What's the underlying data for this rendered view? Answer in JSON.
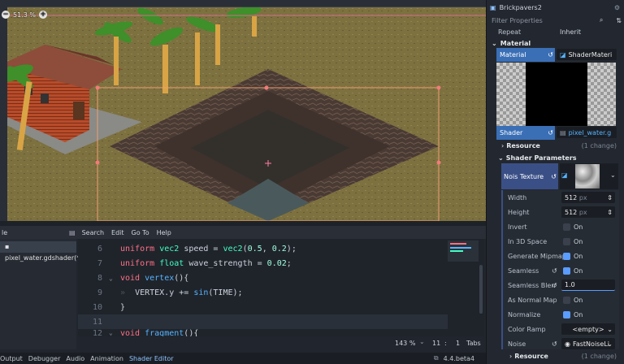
{
  "viewport": {
    "zoom": "51.3 %"
  },
  "editor": {
    "menu": [
      "Search",
      "Edit",
      "Go To",
      "Help"
    ],
    "panel_label": "le",
    "file": "pixel_water.gdshader(*)",
    "lines": [
      {
        "n": "6",
        "code": "uniform vec2 speed = vec2(0.5, 0.2);"
      },
      {
        "n": "7",
        "code": "uniform float wave_strength = 0.02;"
      },
      {
        "n": "8",
        "code": "void vertex(){"
      },
      {
        "n": "9",
        "code": "VERTEX.y += sin(TIME);"
      },
      {
        "n": "10",
        "code": "}"
      },
      {
        "n": "11",
        "code": ""
      },
      {
        "n": "12",
        "code": "void fragment(){"
      }
    ],
    "status": {
      "zoom": "143 %",
      "line": "11",
      "col": "1",
      "indent": "Tabs"
    }
  },
  "bottom_tabs": [
    "Output",
    "Debugger",
    "Audio",
    "Animation",
    "Shader Editor"
  ],
  "version": "4.4.beta4",
  "inspector": {
    "object_name": "Brickpavers2",
    "filter_placeholder": "Filter Properties",
    "repeat": {
      "label": "Repeat",
      "value": "Inherit"
    },
    "material_section": "Material",
    "material": {
      "label": "Material",
      "value": "ShaderMateri"
    },
    "shader": {
      "label": "Shader",
      "value": "pixel_water.g"
    },
    "resource": {
      "label": "Resource",
      "note": "(1 change)"
    },
    "shader_params": "Shader Parameters",
    "noise_texture": {
      "label": "Nois Texture"
    },
    "props": [
      {
        "label": "Width",
        "value": "512",
        "unit": "px"
      },
      {
        "label": "Height",
        "value": "512",
        "unit": "px"
      },
      {
        "label": "Invert",
        "check": false,
        "text": "On"
      },
      {
        "label": "In 3D Space",
        "check": false,
        "text": "On"
      },
      {
        "label": "Generate Mipmap",
        "check": true,
        "text": "On"
      },
      {
        "label": "Seamless",
        "check": true,
        "text": "On"
      },
      {
        "label": "Seamless Blen",
        "value": "1.0"
      },
      {
        "label": "As Normal Map",
        "check": false,
        "text": "On"
      },
      {
        "label": "Normalize",
        "check": true,
        "text": "On"
      },
      {
        "label": "Color Ramp",
        "value": "<empty>"
      },
      {
        "label": "Noise",
        "value": "FastNoiseLi"
      }
    ],
    "resource2": {
      "label": "Resource",
      "note": "(1 change)"
    }
  }
}
